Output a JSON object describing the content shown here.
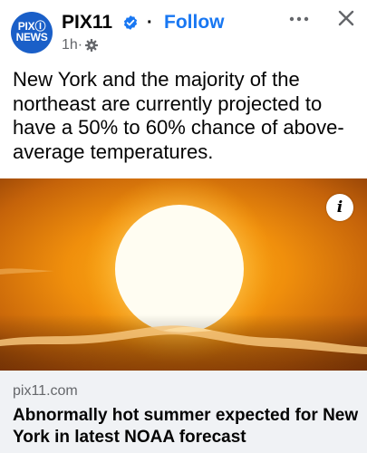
{
  "post": {
    "page_name": "PIX11",
    "follow_label": "Follow",
    "separator": "·",
    "time": "1h",
    "time_separator": "·",
    "avatar_logo_line1": "PIXⒾ",
    "avatar_logo_line2": "NEWS",
    "text": "New York and the majority of the northeast are currently projected to have a 50% to 60% chance of above-average temperatures."
  },
  "link_preview": {
    "domain": "pix11.com",
    "headline": "Abnormally hot summer expected for New York in latest NOAA forecast"
  },
  "icons": {
    "verified": "verified-badge-icon",
    "privacy": "public-globe-gear-icon",
    "more": "more-options-icon",
    "close": "close-icon",
    "info": "info-icon"
  },
  "colors": {
    "brand_blue": "#1877f2",
    "avatar_blue": "#1a5fc8",
    "secondary_text": "#65676b",
    "preview_bg": "#f0f2f5"
  },
  "image": {
    "info_glyph": "i"
  }
}
